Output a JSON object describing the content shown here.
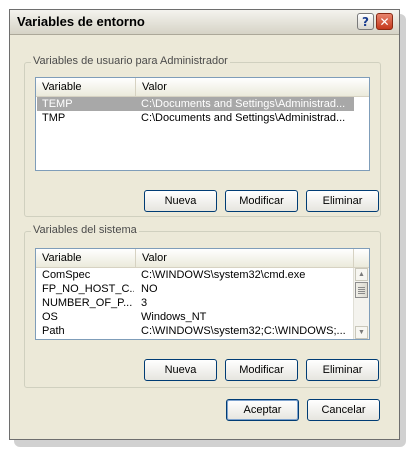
{
  "window": {
    "title": "Variables de entorno",
    "help_label": "?",
    "close_label": "✕"
  },
  "user_vars": {
    "group_label": "Variables de usuario para Administrador",
    "columns": [
      "Variable",
      "Valor"
    ],
    "rows": [
      {
        "variable": "TEMP",
        "value": "C:\\Documents and Settings\\Administrad...",
        "selected": true
      },
      {
        "variable": "TMP",
        "value": "C:\\Documents and Settings\\Administrad...",
        "selected": false
      }
    ],
    "buttons": {
      "new": "Nueva",
      "edit": "Modificar",
      "delete": "Eliminar"
    }
  },
  "system_vars": {
    "group_label": "Variables del sistema",
    "columns": [
      "Variable",
      "Valor"
    ],
    "rows": [
      {
        "variable": "ComSpec",
        "value": "C:\\WINDOWS\\system32\\cmd.exe"
      },
      {
        "variable": "FP_NO_HOST_C...",
        "value": "NO"
      },
      {
        "variable": "NUMBER_OF_P...",
        "value": "3"
      },
      {
        "variable": "OS",
        "value": "Windows_NT"
      },
      {
        "variable": "Path",
        "value": "C:\\WINDOWS\\system32;C:\\WINDOWS;..."
      }
    ],
    "buttons": {
      "new": "Nueva",
      "edit": "Modificar",
      "delete": "Eliminar"
    }
  },
  "dialog_buttons": {
    "ok": "Aceptar",
    "cancel": "Cancelar"
  },
  "colors": {
    "selection": "#a8a8a8",
    "list_border": "#7f9db9",
    "dialog_bg": "#ece9d8"
  }
}
